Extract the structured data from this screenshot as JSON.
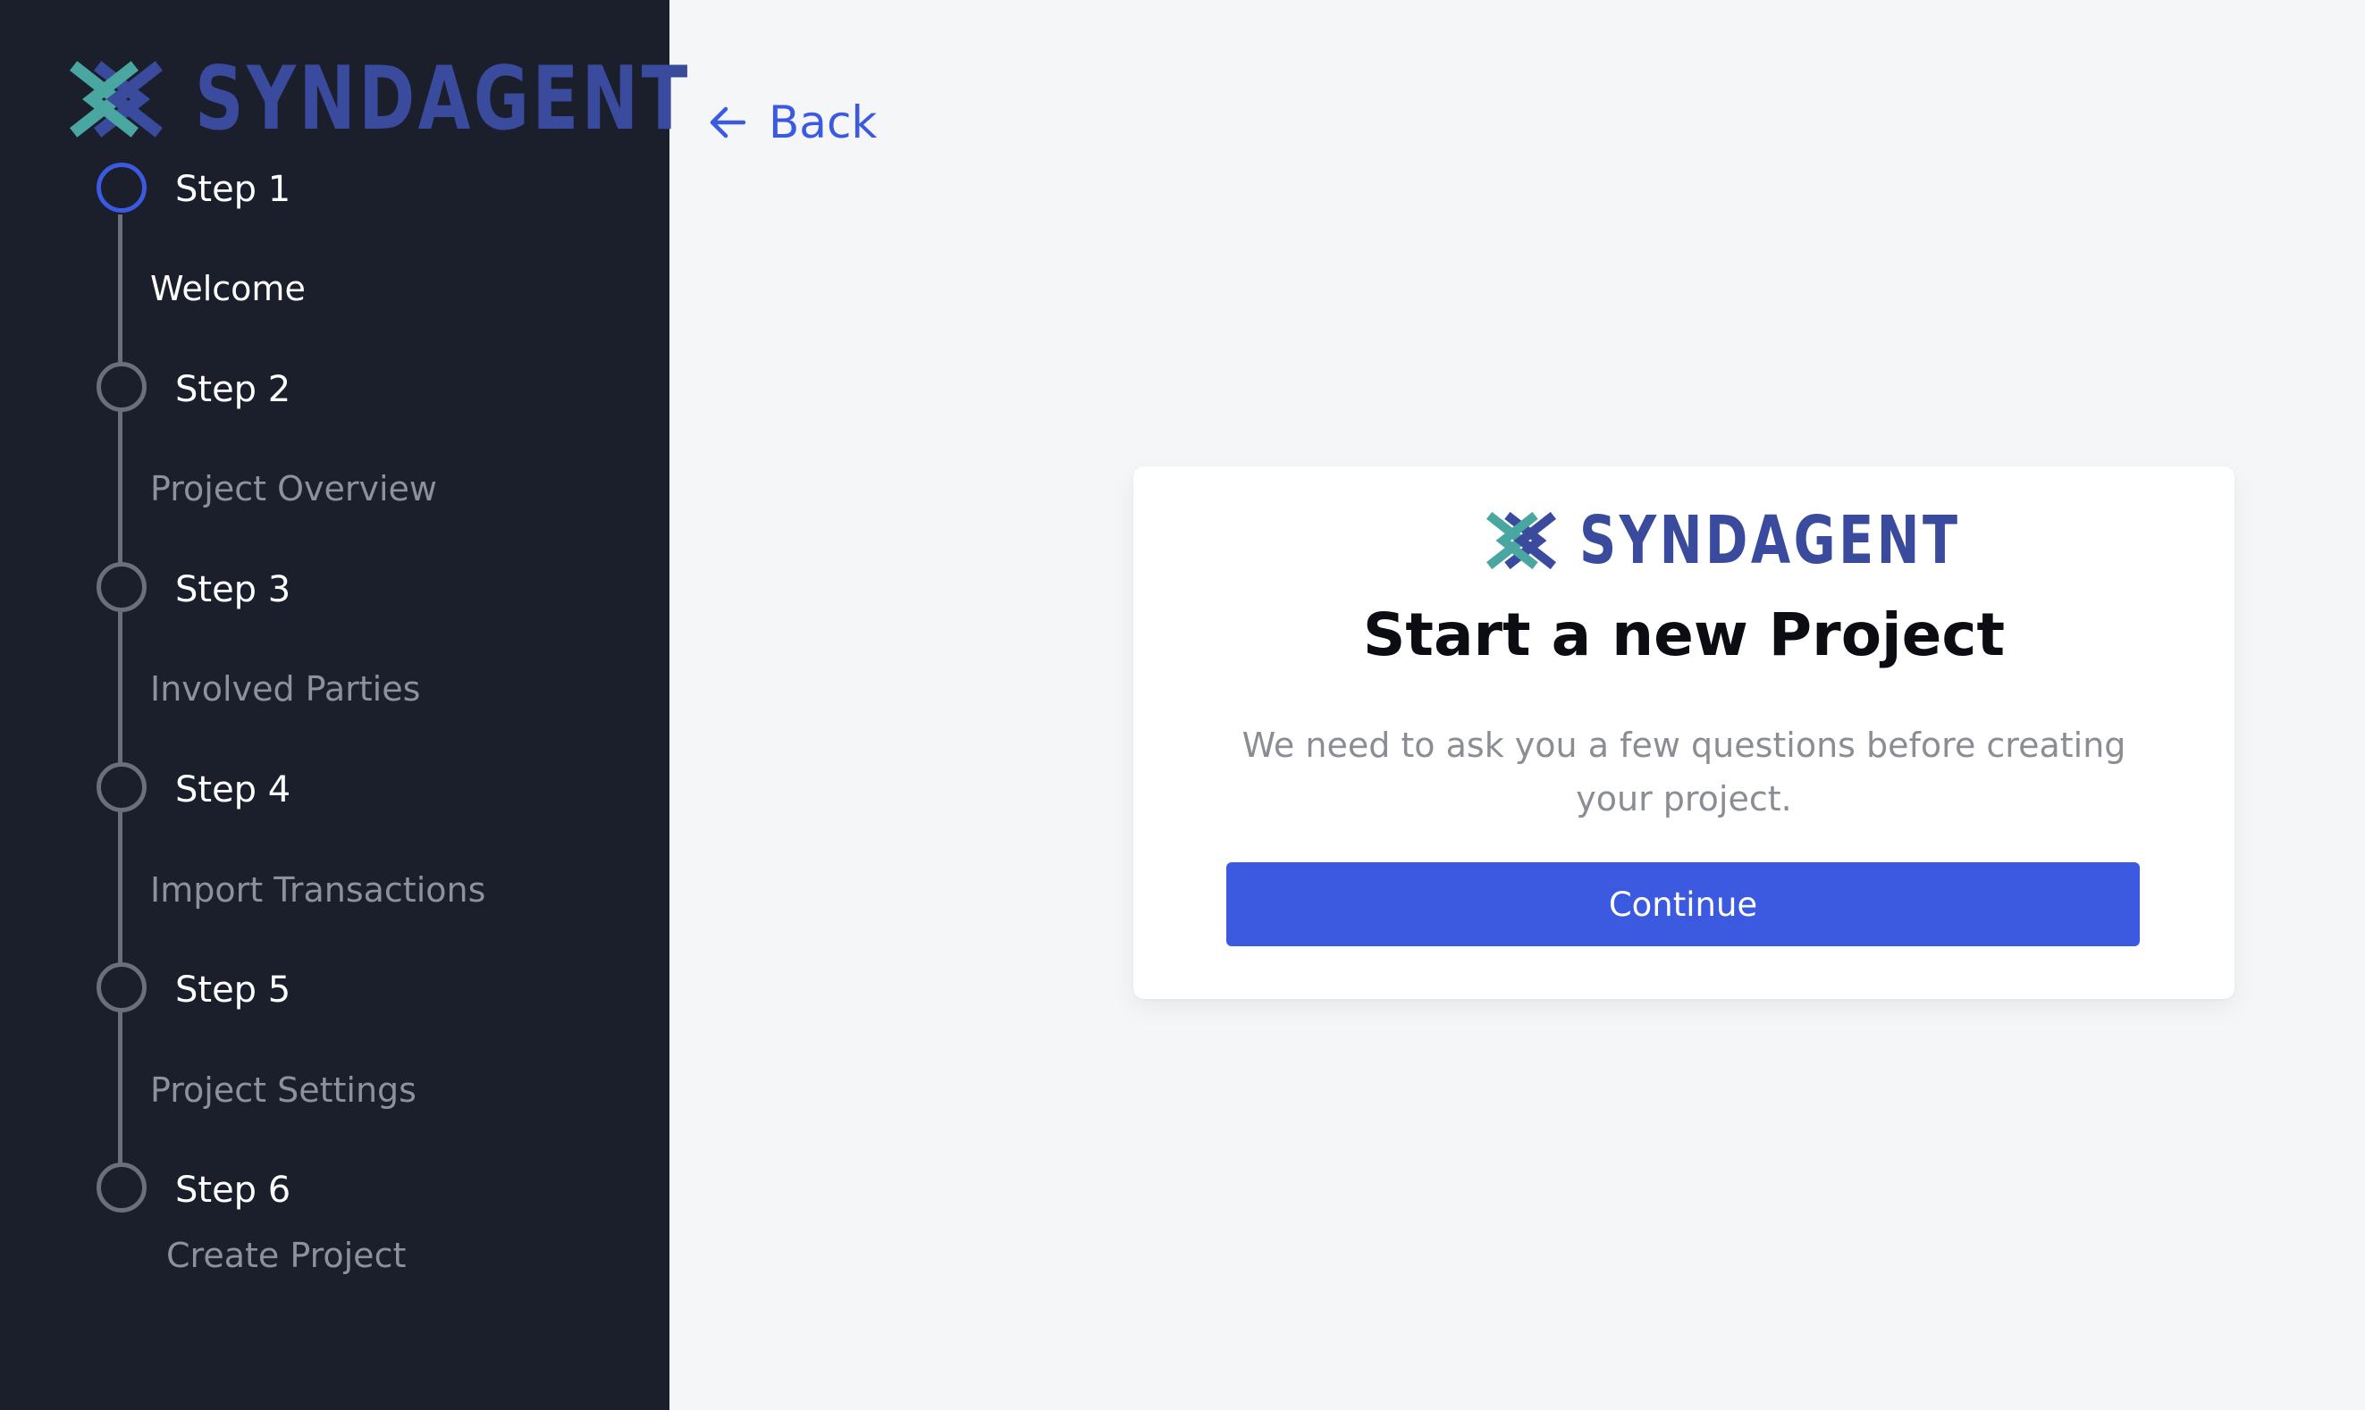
{
  "brand": {
    "name": "SYNDAGENT",
    "colors": {
      "navy": "#3a4a9c",
      "teal": "#4aa6a0",
      "accent": "#3c5ae0"
    },
    "icon": "syndagent-logo-icon"
  },
  "sidebar": {
    "steps": [
      {
        "label": "Step 1",
        "sub": "Welcome",
        "state": "active"
      },
      {
        "label": "Step 2",
        "sub": "Project Overview",
        "state": "pending"
      },
      {
        "label": "Step 3",
        "sub": "Involved Parties",
        "state": "pending"
      },
      {
        "label": "Step 4",
        "sub": "Import Transactions",
        "state": "pending"
      },
      {
        "label": "Step 5",
        "sub": "Project Settings",
        "state": "pending"
      },
      {
        "label": "Step 6",
        "sub": "Create Project",
        "state": "pending"
      }
    ]
  },
  "nav": {
    "back_label": "Back",
    "back_icon": "arrow-left-icon"
  },
  "card": {
    "title": "Start a new Project",
    "description": "We need to ask you a few questions before creating your project.",
    "continue_label": "Continue"
  }
}
